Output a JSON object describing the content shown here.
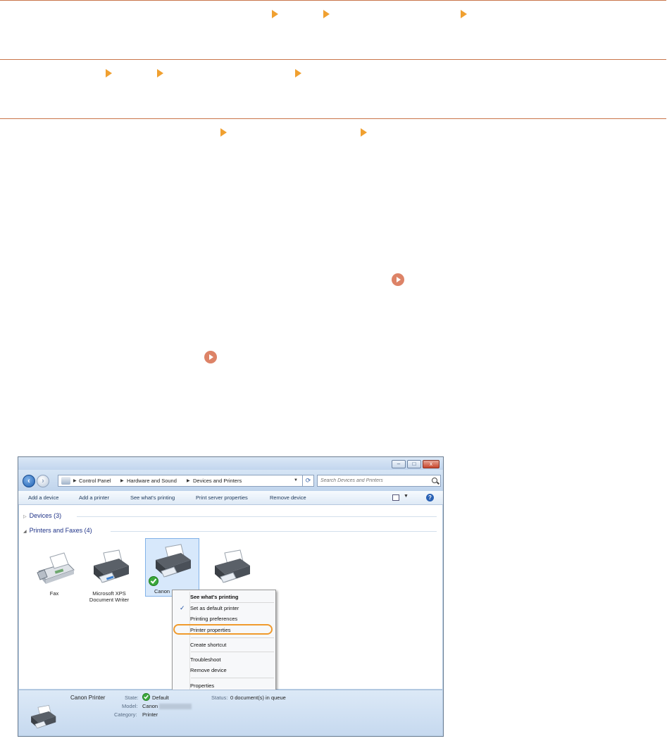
{
  "window": {
    "buttons": {
      "minimize": "–",
      "maximize": "□",
      "close": "x"
    },
    "address": {
      "crumbs": [
        "Control Panel",
        "Hardware and Sound",
        "Devices and Printers"
      ],
      "search_placeholder": "Search Devices and Printers"
    },
    "toolbar": {
      "items": [
        "Add a device",
        "Add a printer",
        "See what's printing",
        "Print server properties",
        "Remove device"
      ]
    },
    "groups": {
      "devices": "Devices (3)",
      "printers": "Printers and Faxes (4)"
    },
    "devices": [
      {
        "label": "Fax"
      },
      {
        "label": "Microsoft XPS Document Writer"
      },
      {
        "label": "Canon"
      },
      {
        "label": ""
      }
    ],
    "context_menu": {
      "items": [
        "See what's printing",
        "Set as default printer",
        "Printing preferences",
        "Printer properties",
        "Create shortcut",
        "Troubleshoot",
        "Remove device",
        "Properties"
      ],
      "highlighted": "Printer properties"
    },
    "details": {
      "name": "Canon Printer",
      "state_label": "State:",
      "state_value": "Default",
      "status_label": "Status:",
      "status_value": "0 document(s) in queue",
      "model_label": "Model:",
      "model_value": "Canon",
      "category_label": "Category:",
      "category_value": "Printer"
    }
  },
  "colors": {
    "accent_orange": "#f0a030",
    "rule": "#c9754a",
    "jump_icon": "#dd8367",
    "highlight_ring": "#f09a2c"
  }
}
